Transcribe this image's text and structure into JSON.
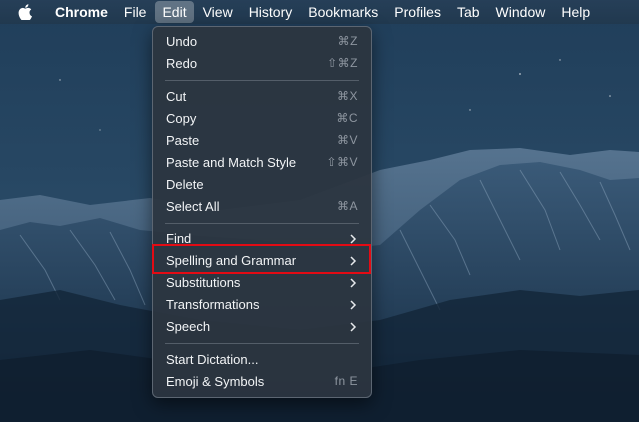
{
  "menubar": {
    "apple_icon": "apple-logo-icon",
    "items": [
      "Chrome",
      "File",
      "Edit",
      "View",
      "History",
      "Bookmarks",
      "Profiles",
      "Tab",
      "Window",
      "Help"
    ]
  },
  "edit_menu": {
    "undo": {
      "label": "Undo",
      "shortcut": "⌘Z"
    },
    "redo": {
      "label": "Redo",
      "shortcut": "⇧⌘Z"
    },
    "cut": {
      "label": "Cut",
      "shortcut": "⌘X"
    },
    "copy": {
      "label": "Copy",
      "shortcut": "⌘C"
    },
    "paste": {
      "label": "Paste",
      "shortcut": "⌘V"
    },
    "paste_match": {
      "label": "Paste and Match Style",
      "shortcut": "⇧⌘V"
    },
    "delete": {
      "label": "Delete"
    },
    "select_all": {
      "label": "Select All",
      "shortcut": "⌘A"
    },
    "find": {
      "label": "Find"
    },
    "spelling": {
      "label": "Spelling and Grammar"
    },
    "substitutions": {
      "label": "Substitutions"
    },
    "transformations": {
      "label": "Transformations"
    },
    "speech": {
      "label": "Speech"
    },
    "dictation": {
      "label": "Start Dictation..."
    },
    "emoji": {
      "label": "Emoji & Symbols",
      "shortcut": "fn E"
    }
  },
  "colors": {
    "highlight_border": "#e30b14",
    "menu_background": "#2c3540",
    "sky": "#1d3b56"
  }
}
